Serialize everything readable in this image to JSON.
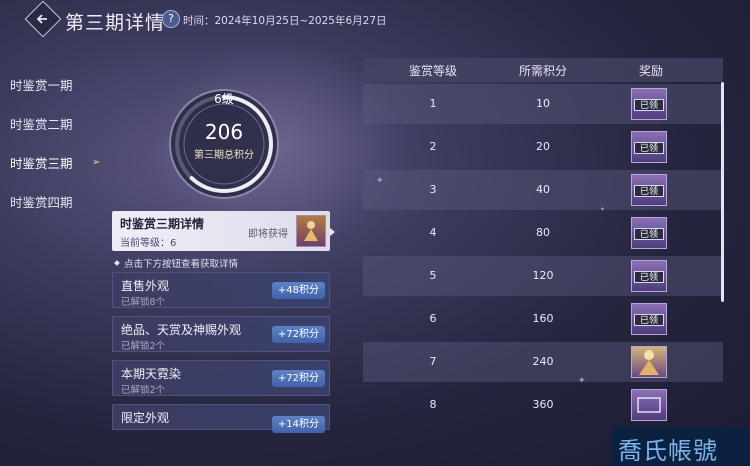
{
  "header": {
    "title": "第三期详情",
    "help": "?",
    "time_text": "时间：2024年10月25日~2025年6月27日"
  },
  "nav": {
    "items": [
      {
        "label": "时鉴赏一期",
        "active": false
      },
      {
        "label": "时鉴赏二期",
        "active": false
      },
      {
        "label": "时鉴赏三期",
        "active": true
      },
      {
        "label": "时鉴赏四期",
        "active": false
      }
    ]
  },
  "progress": {
    "level": "6级",
    "score": "206",
    "score_label": "第三期总积分",
    "ring_fraction": 0.62
  },
  "current_card": {
    "title": "时鉴赏三期详情",
    "level": "当前等级：6",
    "status": "即将获得"
  },
  "hint": "点击下方按钮查看获取详情",
  "sources": [
    {
      "title": "直售外观",
      "sub": "已解锁8个",
      "points": "+48积分"
    },
    {
      "title": "绝品、天赏及神赐外观",
      "sub": "已解锁2个",
      "points": "+72积分"
    },
    {
      "title": "本期天霓染",
      "sub": "已解锁2个",
      "points": "+72积分"
    },
    {
      "title": "限定外观",
      "sub": "",
      "points": "+14积分"
    }
  ],
  "table": {
    "headers": [
      "鉴赏等级",
      "所需积分",
      "奖励"
    ],
    "rows": [
      {
        "level": "1",
        "points": "10",
        "reward": "已领"
      },
      {
        "level": "2",
        "points": "20",
        "reward": "已领"
      },
      {
        "level": "3",
        "points": "40",
        "reward": "已领"
      },
      {
        "level": "4",
        "points": "80",
        "reward": "已领"
      },
      {
        "level": "5",
        "points": "120",
        "reward": "已领"
      },
      {
        "level": "6",
        "points": "160",
        "reward": "已领"
      },
      {
        "level": "7",
        "points": "240",
        "reward": ""
      },
      {
        "level": "8",
        "points": "360",
        "reward": ""
      }
    ]
  },
  "watermark": "喬氏帳號",
  "colors": {
    "accent": "#f3d27a",
    "badge": "#3f62a8",
    "bg": "#2a2a45"
  }
}
